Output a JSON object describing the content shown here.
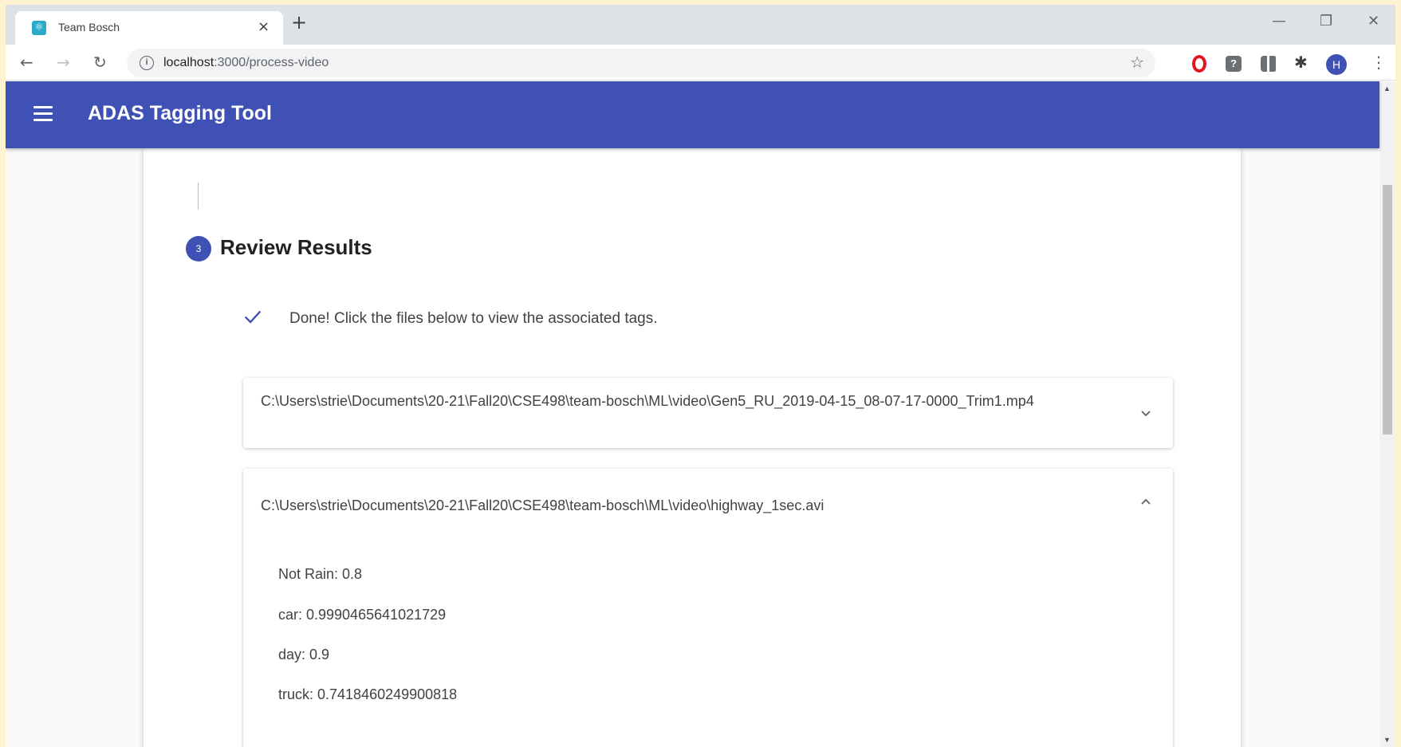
{
  "browser": {
    "tab_title": "Team Bosch",
    "tab_close": "×",
    "new_tab": "+",
    "url_host": "localhost",
    "url_path": ":3000/process-video",
    "window_controls": {
      "minimize": "—",
      "restore": "❐",
      "close": "✕"
    }
  },
  "app": {
    "title": "ADAS Tagging Tool",
    "primary_color": "#3f51b5"
  },
  "step": {
    "number": "3",
    "title": "Review Results"
  },
  "status": {
    "message": "Done! Click the files below to view the associated tags."
  },
  "files": [
    {
      "path": "C:\\Users\\strie\\Documents\\20-21\\Fall20\\CSE498\\team-bosch\\ML\\video\\Gen5_RU_2019-04-15_08-07-17-0000_Trim1.mp4",
      "expanded": false
    },
    {
      "path": "C:\\Users\\strie\\Documents\\20-21\\Fall20\\CSE498\\team-bosch\\ML\\video\\highway_1sec.avi",
      "expanded": true,
      "tags": [
        "Not Rain: 0.8",
        "car: 0.9990465641021729",
        "day: 0.9",
        "truck: 0.7418460249900818"
      ]
    }
  ]
}
